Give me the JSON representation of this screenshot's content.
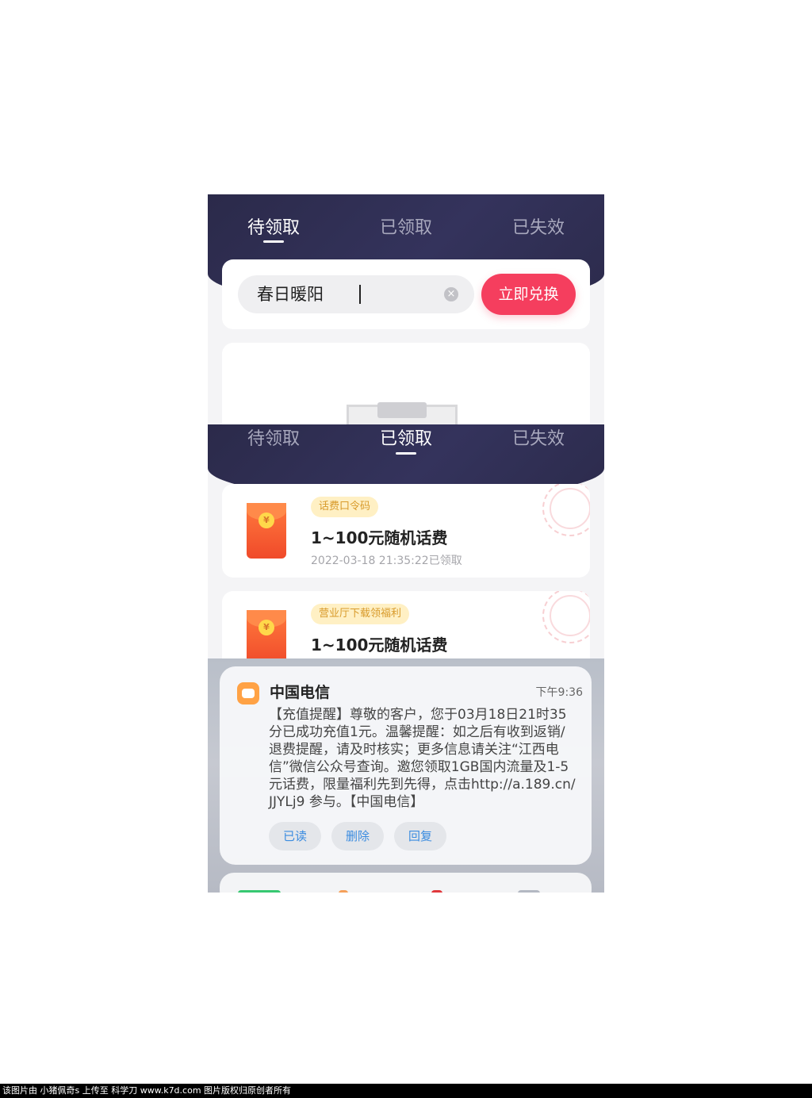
{
  "tabs": [
    "待领取",
    "已领取",
    "已失效"
  ],
  "redeem": {
    "code_value": "春日暖阳",
    "button_label": "立即兑换"
  },
  "coupons": [
    {
      "tag": "话费口令码",
      "title": "1~100元随机话费",
      "date": "2022-03-18  21:35:22已领取"
    },
    {
      "tag": "营业厅下载领福利",
      "title": "1~100元随机话费"
    }
  ],
  "notification": {
    "sender": "中国电信",
    "time": "下午9:36",
    "body": "【充值提醒】尊敬的客户，您于03月18日21时35分已成功充值1元。温馨提醒：如之后有收到返销/退费提醒，请及时核实；更多信息请关注“江西电信”微信公众号查询。邀您领取1GB国内流量及1-5元话费，限量福利先到先得，点击http://a.189.cn/JJYLj9 参与。【中国电信】",
    "actions": [
      "已读",
      "删除",
      "回复"
    ]
  },
  "footer": "该图片由 小猪佩奇s 上传至 科学刀 www.k7d.com 图片版权归原创者所有",
  "colors": {
    "header": "#2b2a4a",
    "accent": "#f53e5e",
    "tag_bg": "#fff0c4",
    "tag_text": "#d89a2a",
    "action_text": "#3b8ce0"
  },
  "icons": {
    "coin": "¥",
    "clear": "×"
  }
}
